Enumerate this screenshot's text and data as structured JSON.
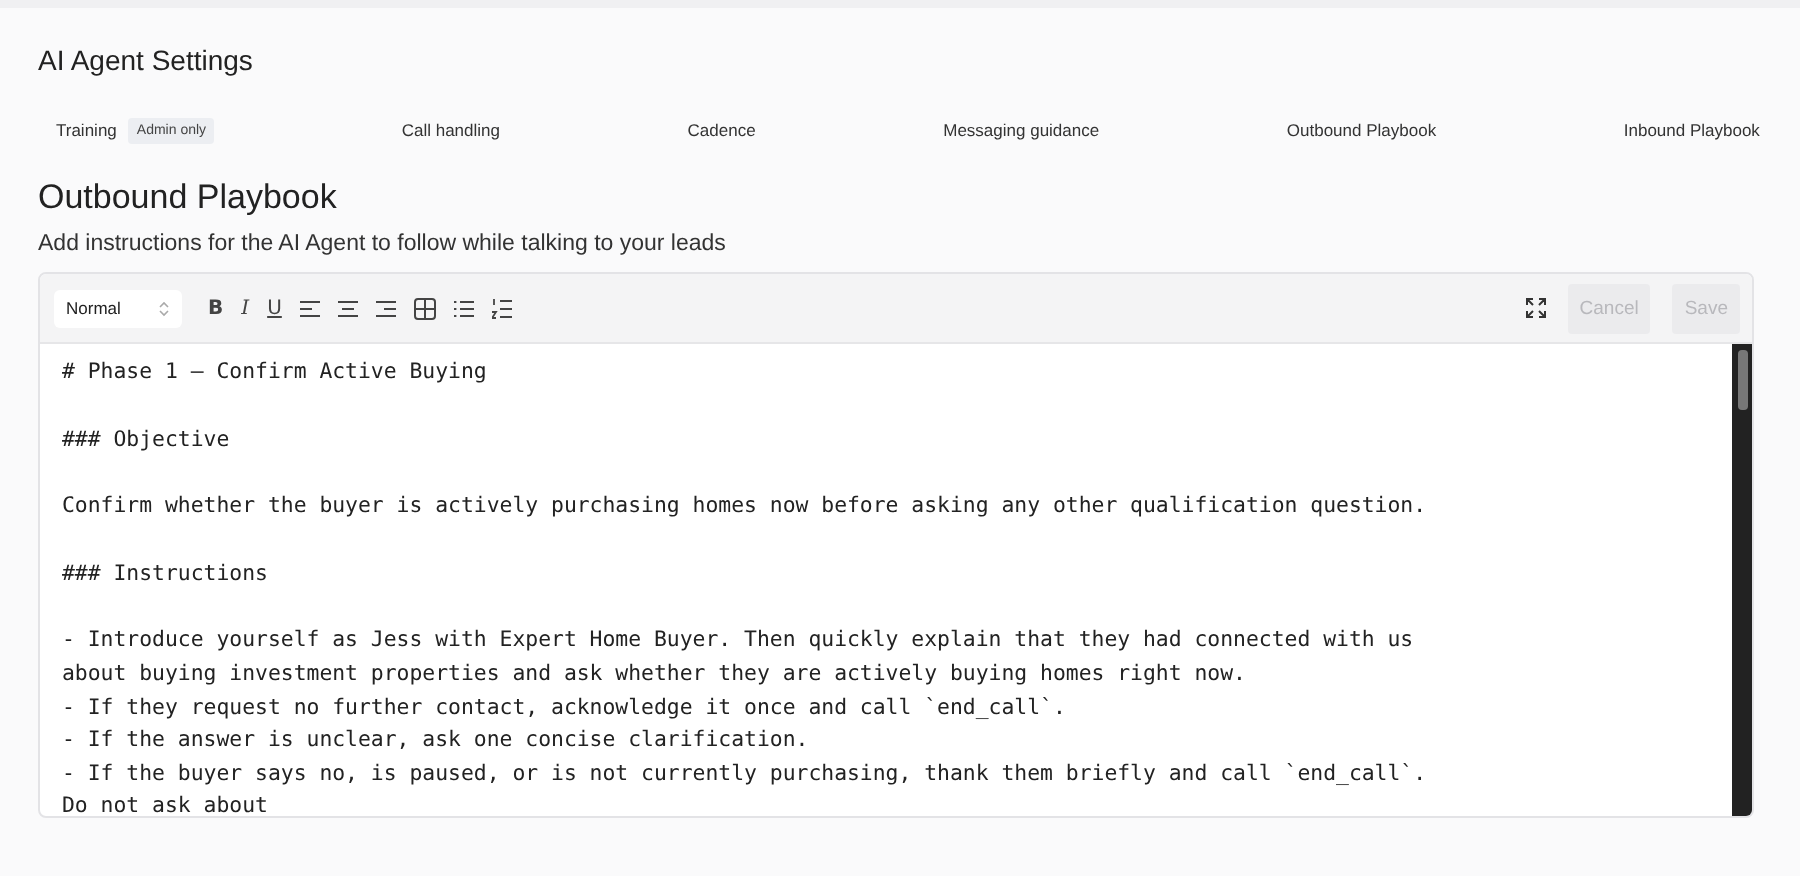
{
  "page_title": "AI Agent Settings",
  "tabs": [
    {
      "label": "Training",
      "badge": "Admin only"
    },
    {
      "label": "Call handling"
    },
    {
      "label": "Cadence"
    },
    {
      "label": "Messaging guidance"
    },
    {
      "label": "Outbound Playbook"
    },
    {
      "label": "Inbound Playbook"
    }
  ],
  "section": {
    "title": "Outbound Playbook",
    "description": "Add instructions for the AI Agent to follow while talking to your leads"
  },
  "toolbar": {
    "style_select": "Normal",
    "format_buttons": [
      "B",
      "I",
      "U"
    ],
    "cancel": {
      "label": "Cancel",
      "disabled": true
    },
    "save": {
      "label": "Save",
      "disabled": true
    }
  },
  "editor_blocks": [
    {
      "kind": "line",
      "text": "# Phase 1 – Confirm Active Buying"
    },
    {
      "kind": "line",
      "text": "### Objective"
    },
    {
      "kind": "line",
      "text": "Confirm whether the buyer is actively purchasing homes now before asking any other qualification question."
    },
    {
      "kind": "line",
      "text": "### Instructions"
    },
    {
      "kind": "list",
      "items": [
        "- Introduce yourself as Jess with Expert Home Buyer. Then quickly explain that they had connected with us about buying investment properties and ask whether they are actively buying homes right now.",
        "- If they request no further contact, acknowledge it once and call `end_call`.",
        "- If the answer is unclear, ask one concise clarification.",
        "- If the buyer says no, is paused, or is not currently purchasing, thank them briefly and call `end_call`. Do not ask about"
      ]
    }
  ]
}
